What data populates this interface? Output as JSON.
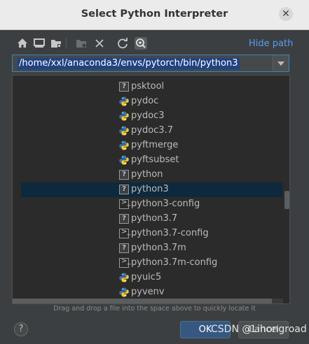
{
  "dialog": {
    "title": "Select Python Interpreter",
    "close_glyph": "✕"
  },
  "toolbar": {
    "buttons": [
      "home-icon",
      "desktop-icon",
      "project-folder-icon",
      "new-folder-icon",
      "delete-icon",
      "refresh-icon",
      "show-hidden-icon"
    ],
    "hide_path_label": "Hide path"
  },
  "path": {
    "value": "/home/xxl/anaconda3/envs/pytorch/bin/python3"
  },
  "tree": {
    "items": [
      {
        "label": "psktool",
        "icon": "unknown-file-icon"
      },
      {
        "label": "pydoc",
        "icon": "python-file-icon"
      },
      {
        "label": "pydoc3",
        "icon": "python-file-icon"
      },
      {
        "label": "pydoc3.7",
        "icon": "python-file-icon"
      },
      {
        "label": "pyftmerge",
        "icon": "python-file-icon"
      },
      {
        "label": "pyftsubset",
        "icon": "python-file-icon"
      },
      {
        "label": "python",
        "icon": "unknown-file-icon"
      },
      {
        "label": "python3",
        "icon": "unknown-file-icon",
        "selected": true
      },
      {
        "label": "python3-config",
        "icon": "terminal-file-icon"
      },
      {
        "label": "python3.7",
        "icon": "unknown-file-icon"
      },
      {
        "label": "python3.7-config",
        "icon": "terminal-file-icon"
      },
      {
        "label": "python3.7m",
        "icon": "unknown-file-icon"
      },
      {
        "label": "python3.7m-config",
        "icon": "terminal-file-icon"
      },
      {
        "label": "pyuic5",
        "icon": "python-file-icon"
      },
      {
        "label": "pyvenv",
        "icon": "python-file-icon"
      }
    ]
  },
  "hint": "Drag and drop a file into the space above to quickly locate it",
  "footer": {
    "help_glyph": "?",
    "ok_label": "OK",
    "cancel_label": "Cancel",
    "watermark": "CSDN @Lihongroad"
  },
  "colors": {
    "background": "#3c3f41",
    "selection": "#0d293e",
    "link": "#589df6",
    "ok_button": "#365880"
  }
}
